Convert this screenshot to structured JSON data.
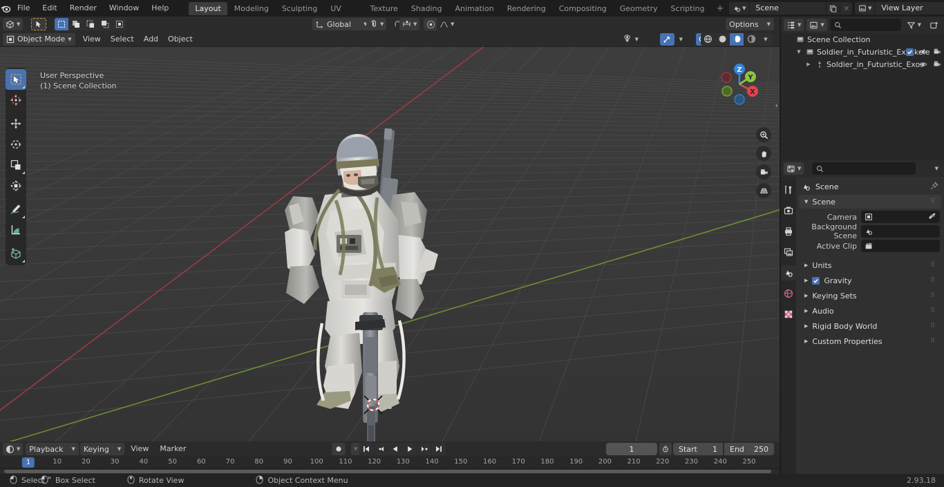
{
  "app": {
    "version": "2.93.18"
  },
  "topbar": {
    "logo_icon": "blender-logo-icon",
    "menus": [
      "File",
      "Edit",
      "Render",
      "Window",
      "Help"
    ],
    "workspaces": [
      {
        "label": "Layout",
        "active": true
      },
      {
        "label": "Modeling",
        "active": false
      },
      {
        "label": "Sculpting",
        "active": false
      },
      {
        "label": "UV Editing",
        "active": false
      },
      {
        "label": "Texture Paint",
        "active": false
      },
      {
        "label": "Shading",
        "active": false
      },
      {
        "label": "Animation",
        "active": false
      },
      {
        "label": "Rendering",
        "active": false
      },
      {
        "label": "Compositing",
        "active": false
      },
      {
        "label": "Geometry Nodes",
        "active": false
      },
      {
        "label": "Scripting",
        "active": false
      }
    ],
    "add_workspace_label": "+",
    "scene_selector": {
      "icon": "scene-icon",
      "value": "Scene",
      "copy_icon": "duplicate-icon",
      "unlink_icon": "x-icon"
    },
    "viewlayer_selector": {
      "icon": "viewlayer-icon",
      "value": "View Layer",
      "copy_icon": "duplicate-icon",
      "unlink_icon": "x-icon"
    }
  },
  "viewport": {
    "header": {
      "editor_type_icon": "editor-type-3dview-icon",
      "mode": "Object Mode",
      "mode_icon": "object-mode-icon",
      "menus": [
        "View",
        "Select",
        "Add",
        "Object"
      ],
      "select_mode_icons": [
        "cursor-select-icon",
        "select-set-icon",
        "select-extend-icon",
        "select-subtract-icon",
        "select-difference-icon",
        "select-intersect-icon"
      ],
      "transform_orientation": "Global",
      "transform_orientation_icon": "orientation-global-icon",
      "snap_icon": "magnet-icon",
      "proportional_edit_icon": "proportional-edit-icon",
      "proportional_falloff_icon": "falloff-smooth-icon",
      "options_label": "Options",
      "visibility_icon": "visibility-icon",
      "gizmo_icon": "gizmo-icon",
      "overlays_icon": "overlays-icon",
      "xray_icon": "xray-icon",
      "shading_modes": [
        "wireframe-icon",
        "solid-icon",
        "material-preview-icon",
        "rendered-icon"
      ],
      "shading_active_index": 2
    },
    "overlay_text": {
      "line1": "User Perspective",
      "line2": "(1) Scene Collection"
    },
    "toolbar": [
      {
        "name": "tweak-tool",
        "icon": "cursor-arrow-icon",
        "active": true
      },
      {
        "name": "cursor-tool",
        "icon": "3d-cursor-icon",
        "active": false
      },
      {
        "name": "move-tool",
        "icon": "move-arrows-icon",
        "active": false
      },
      {
        "name": "rotate-tool",
        "icon": "rotate-icon",
        "active": false
      },
      {
        "name": "scale-tool",
        "icon": "scale-icon",
        "active": false
      },
      {
        "name": "transform-tool",
        "icon": "transform-icon",
        "active": false
      },
      {
        "name": "annotate-tool",
        "icon": "pencil-icon",
        "active": false
      },
      {
        "name": "measure-tool",
        "icon": "ruler-icon",
        "active": false
      },
      {
        "name": "add-cube-tool",
        "icon": "add-cube-icon",
        "active": false
      }
    ],
    "gizmo": {
      "axes": [
        "X",
        "Y",
        "Z"
      ],
      "colors": {
        "x": "#e0454f",
        "y": "#8cc641",
        "z": "#3585d6"
      }
    },
    "side_buttons": [
      "zoom-icon",
      "hand-pan-icon",
      "camera-view-icon",
      "orthographic-toggle-icon"
    ],
    "collapse_icon": "chevron-left-icon",
    "scene_object_label": "Soldier_in_Futuristic_Exoskeleton"
  },
  "outliner": {
    "editor_type_icon": "editor-type-outliner-icon",
    "display_mode_icon": "view-layer-icon",
    "search_placeholder": "",
    "search_icon": "search-icon",
    "filter_icon": "filter-icon",
    "new_collection_icon": "new-collection-icon",
    "rows": [
      {
        "label": "Scene Collection",
        "icon": "collection-icon",
        "indent": 0,
        "expander": "",
        "selected": false,
        "checkbox": false,
        "eye": false,
        "camera": false
      },
      {
        "label": "Soldier_in_Futuristic_Exoskele",
        "icon": "collection-icon",
        "indent": 1,
        "expander": "down",
        "selected": false,
        "checkbox": true,
        "eye": true,
        "camera": true
      },
      {
        "label": "Soldier_in_Futuristic_Exos",
        "icon": "armature-icon",
        "indent": 2,
        "expander": "right",
        "selected": false,
        "checkbox": false,
        "eye": true,
        "camera": true
      }
    ]
  },
  "properties": {
    "editor_type_icon": "editor-type-properties-icon",
    "search_placeholder": "",
    "search_icon": "search-icon",
    "dropdown_icon": "chevron-down-icon",
    "tabs": [
      {
        "name": "tool-tab",
        "icon": "tool-wrench-icon",
        "active": false,
        "color": "#cfcfcf"
      },
      {
        "name": "render-tab",
        "icon": "render-camera-icon",
        "active": false,
        "color": "#cfcfcf"
      },
      {
        "name": "output-tab",
        "icon": "printer-icon",
        "active": false,
        "color": "#cfcfcf"
      },
      {
        "name": "viewlayer-tab",
        "icon": "images-icon",
        "active": false,
        "color": "#cfcfcf"
      },
      {
        "name": "scene-tab",
        "icon": "scene-cone-icon",
        "active": true,
        "color": "#e8e8e8"
      },
      {
        "name": "world-tab",
        "icon": "world-globe-icon",
        "active": false,
        "color": "#d06a8c"
      },
      {
        "name": "texture-tab",
        "icon": "checker-texture-icon",
        "active": false,
        "color": "#d06a8c"
      }
    ],
    "breadcrumb": {
      "icon": "scene-cone-icon",
      "label": "Scene",
      "pin_icon": "pin-icon"
    },
    "panels": [
      {
        "label": "Scene",
        "expanded": true,
        "type": "header"
      },
      {
        "label": "Units",
        "expanded": false,
        "type": "collapsed"
      },
      {
        "label": "Gravity",
        "expanded": false,
        "type": "collapsed",
        "checkbox": true
      },
      {
        "label": "Keying Sets",
        "expanded": false,
        "type": "collapsed"
      },
      {
        "label": "Audio",
        "expanded": false,
        "type": "collapsed"
      },
      {
        "label": "Rigid Body World",
        "expanded": false,
        "type": "collapsed"
      },
      {
        "label": "Custom Properties",
        "expanded": false,
        "type": "collapsed"
      }
    ],
    "scene_fields": [
      {
        "label": "Camera",
        "value": "",
        "icon": "camera-object-icon",
        "eyedropper": true
      },
      {
        "label": "Background Scene",
        "value": "",
        "icon": "scene-cone-icon",
        "eyedropper": false
      },
      {
        "label": "Active Clip",
        "value": "",
        "icon": "movie-clip-icon",
        "eyedropper": false
      }
    ]
  },
  "timeline": {
    "editor_type_icon": "editor-type-timeline-icon",
    "menus": [
      "Playback",
      "Keying",
      "View",
      "Marker"
    ],
    "menus_with_chevron": [
      true,
      true,
      false,
      false
    ],
    "record_icon": "record-keyframe-icon",
    "transport": [
      "jump-start-icon",
      "prev-keyframe-icon",
      "play-reverse-icon",
      "play-icon",
      "next-keyframe-icon",
      "jump-end-icon"
    ],
    "current_frame": "1",
    "use_preview_range_icon": "stopwatch-icon",
    "start_label": "Start",
    "start_value": "1",
    "end_label": "End",
    "end_value": "250",
    "ruler_ticks": [
      {
        "label": "10",
        "frame": 10
      },
      {
        "label": "20",
        "frame": 20
      },
      {
        "label": "30",
        "frame": 30
      },
      {
        "label": "40",
        "frame": 40
      },
      {
        "label": "50",
        "frame": 50
      },
      {
        "label": "60",
        "frame": 60
      },
      {
        "label": "70",
        "frame": 70
      },
      {
        "label": "80",
        "frame": 80
      },
      {
        "label": "90",
        "frame": 90
      },
      {
        "label": "100",
        "frame": 100
      },
      {
        "label": "110",
        "frame": 110
      },
      {
        "label": "120",
        "frame": 120
      },
      {
        "label": "130",
        "frame": 130
      },
      {
        "label": "140",
        "frame": 140
      },
      {
        "label": "150",
        "frame": 150
      },
      {
        "label": "160",
        "frame": 160
      },
      {
        "label": "170",
        "frame": 170
      },
      {
        "label": "180",
        "frame": 180
      },
      {
        "label": "190",
        "frame": 190
      },
      {
        "label": "200",
        "frame": 200
      },
      {
        "label": "210",
        "frame": 210
      },
      {
        "label": "220",
        "frame": 220
      },
      {
        "label": "230",
        "frame": 230
      },
      {
        "label": "240",
        "frame": 240
      },
      {
        "label": "250",
        "frame": 250
      }
    ],
    "playhead_label": "1"
  },
  "statusbar": {
    "items": [
      {
        "icon": "mouse-left-icon",
        "label": "Select"
      },
      {
        "icon": "mouse-left-drag-icon",
        "label": "Box Select"
      },
      {
        "icon": "mouse-middle-icon",
        "label": "Rotate View"
      },
      {
        "icon": "mouse-right-icon",
        "label": "Object Context Menu"
      }
    ],
    "version": "2.93.18"
  }
}
